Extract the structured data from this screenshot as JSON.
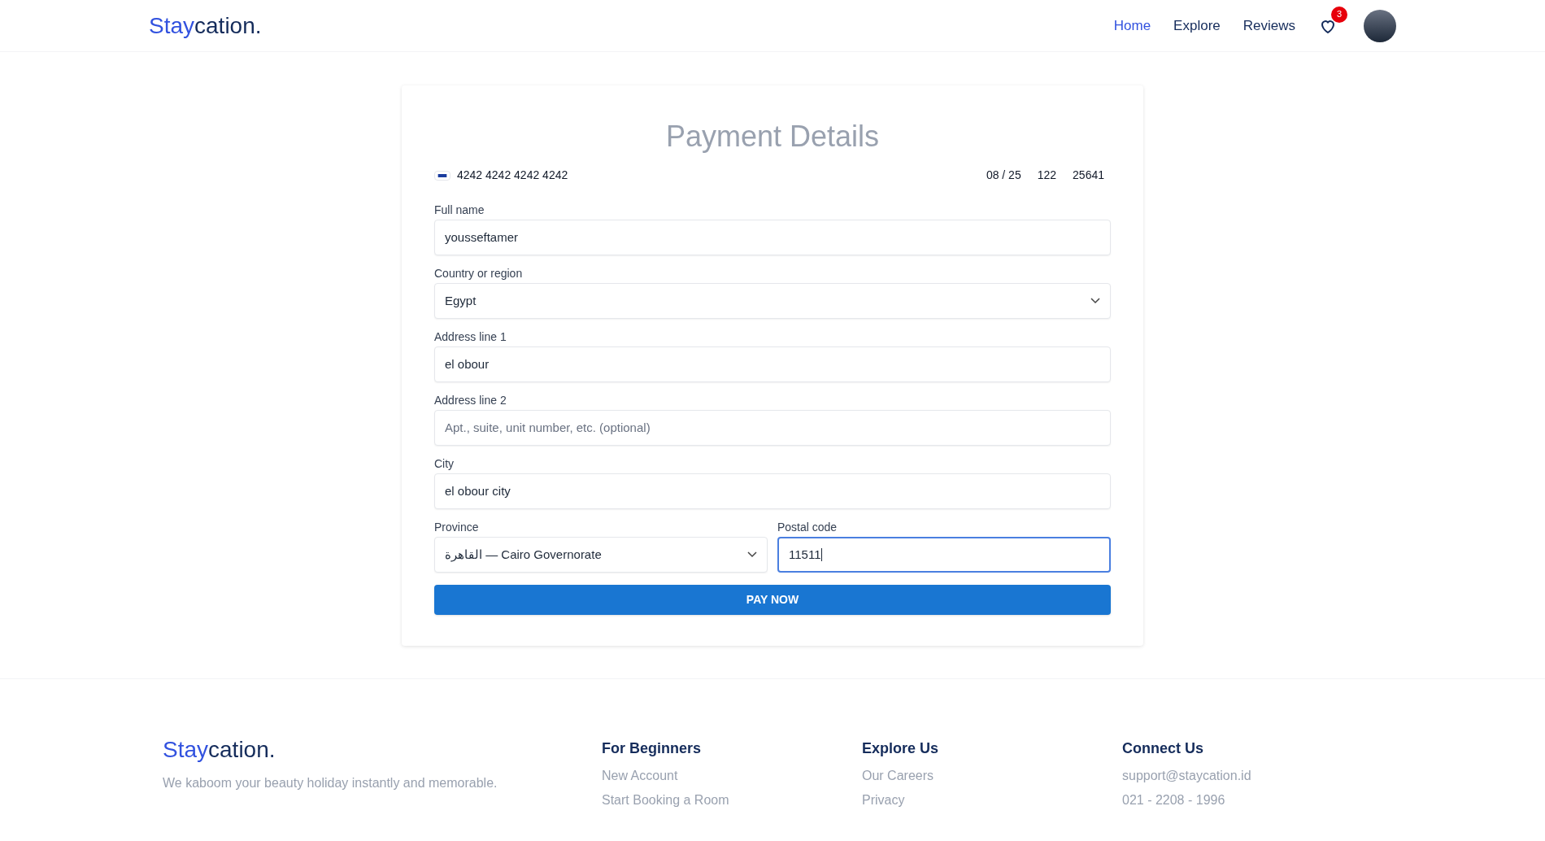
{
  "header": {
    "logo": {
      "accent": "Stay",
      "rest": "cation."
    },
    "nav": [
      {
        "label": "Home",
        "selected": true
      },
      {
        "label": "Explore",
        "selected": false
      },
      {
        "label": "Reviews",
        "selected": false
      }
    ],
    "favorites_badge": "3"
  },
  "payment": {
    "title": "Payment Details",
    "card": {
      "number": "4242 4242 4242 4242",
      "expiry": "08 / 25",
      "cvc": "122",
      "zip": "25641"
    },
    "fields": [
      {
        "kind": "text",
        "label": "Full name",
        "value": "yousseftamer",
        "focused": false
      },
      {
        "kind": "select",
        "label": "Country or region",
        "value": "Egypt",
        "focused": false
      },
      {
        "kind": "text",
        "label": "Address line 1",
        "value": "el obour",
        "focused": false
      },
      {
        "kind": "text",
        "label": "Address line 2",
        "placeholder": "Apt., suite, unit number, etc. (optional)",
        "focused": false
      },
      {
        "kind": "text",
        "label": "City",
        "value": "el obour city",
        "focused": false
      }
    ],
    "row_fields": [
      {
        "kind": "select",
        "label": "Province",
        "value": "القاهرة — Cairo Governorate",
        "focused": false
      },
      {
        "kind": "text",
        "label": "Postal code",
        "value": "11511",
        "focused": true
      }
    ],
    "submit": "PAY NOW"
  },
  "footer": {
    "logo": {
      "accent": "Stay",
      "rest": "cation."
    },
    "tagline": "We kaboom your beauty holiday instantly and memorable.",
    "columns": [
      {
        "heading": "For Beginners",
        "links": [
          "New Account",
          "Start Booking a Room"
        ]
      },
      {
        "heading": "Explore Us",
        "links": [
          "Our Careers",
          "Privacy"
        ]
      },
      {
        "heading": "Connect Us",
        "links": [
          "support@staycation.id",
          "021 - 2208 - 1996"
        ]
      }
    ]
  }
}
